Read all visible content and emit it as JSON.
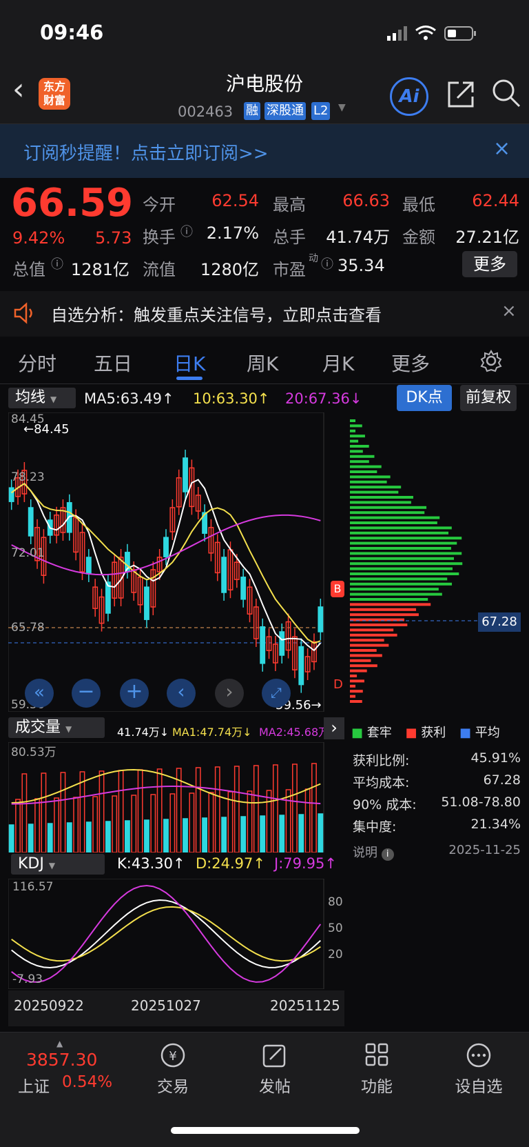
{
  "status": {
    "time": "09:46"
  },
  "header": {
    "title": "沪电股份",
    "code": "002463",
    "tags": [
      "融",
      "深股通",
      "L2"
    ],
    "logo": "东方\n财富",
    "ai": "Ai"
  },
  "banner": {
    "text": "订阅秒提醒！点击立即订阅>>",
    "close": "×"
  },
  "quote": {
    "price": "66.59",
    "change_pct": "9.42%",
    "change": "5.73",
    "open_label": "今开",
    "open": "62.54",
    "high_label": "最高",
    "high": "66.63",
    "low_label": "最低",
    "low": "62.44",
    "turnover_label": "换手",
    "turnover": "2.17%",
    "volume_label": "总手",
    "volume": "41.74万",
    "amount_label": "金额",
    "amount": "27.21亿",
    "mcap_label": "总值",
    "mcap": "1281亿",
    "float_label": "流值",
    "float": "1280亿",
    "pe_label": "市盈",
    "pe_sup": "动",
    "pe": "35.34",
    "more": "更多"
  },
  "notice": {
    "text": "自选分析：触发重点关注信号，立即点击查看"
  },
  "tabs": [
    "分时",
    "五日",
    "日K",
    "周K",
    "月K",
    "更多"
  ],
  "active_tab": "日K",
  "chart": {
    "ma_select": "均线",
    "ma5": "MA5:63.49↑",
    "ma10": "10:63.30↑",
    "ma20": "20:67.36↓",
    "dk": "DK点",
    "fq": "前复权",
    "price_labels": [
      "84.45",
      "78.23",
      "72.01",
      "65.78",
      "59.56"
    ],
    "high_mark": "←84.45",
    "low_mark": "59.56→",
    "b_mark": "B",
    "d_mark": "D",
    "vol_select": "成交量",
    "vol": "41.74万↓",
    "vol_ma1": "MA1:47.74万↓",
    "vol_ma2": "MA2:45.68万",
    "vol_max": "80.53万",
    "kdj_select": "KDJ",
    "k": "K:43.30↑",
    "d": "D:24.97↑",
    "j": "J:79.95↑",
    "kdj_labels": [
      "116.57",
      "-7.93"
    ],
    "kdj_levels": [
      "80",
      "50",
      "20"
    ],
    "dates": [
      "20250922",
      "20251027",
      "20251125"
    ],
    "colors": {
      "up": "#ff3b30",
      "down": "#2fd8e0",
      "ma5": "#ffffff",
      "ma10": "#f4e04d",
      "ma20": "#d63adf"
    }
  },
  "chip": {
    "avg_price": "67.28",
    "legend": [
      "套牢",
      "获利",
      "平均"
    ],
    "stats": [
      {
        "label": "获利比例:",
        "value": "45.91%"
      },
      {
        "label": "平均成本:",
        "value": "67.28"
      },
      {
        "label": "90% 成本:",
        "value": "51.08-78.80"
      },
      {
        "label": "集中度:",
        "value": "21.34%"
      }
    ],
    "note": "说明",
    "date": "2025-11-25"
  },
  "bottom": {
    "index_value": "3857.30",
    "index_name": "上证",
    "index_pct": "0.54%",
    "items": [
      {
        "label": "交易",
        "icon": "yen-icon"
      },
      {
        "label": "发帖",
        "icon": "edit-icon"
      },
      {
        "label": "功能",
        "icon": "grid-icon"
      },
      {
        "label": "设自选",
        "icon": "more-icon"
      }
    ]
  }
}
